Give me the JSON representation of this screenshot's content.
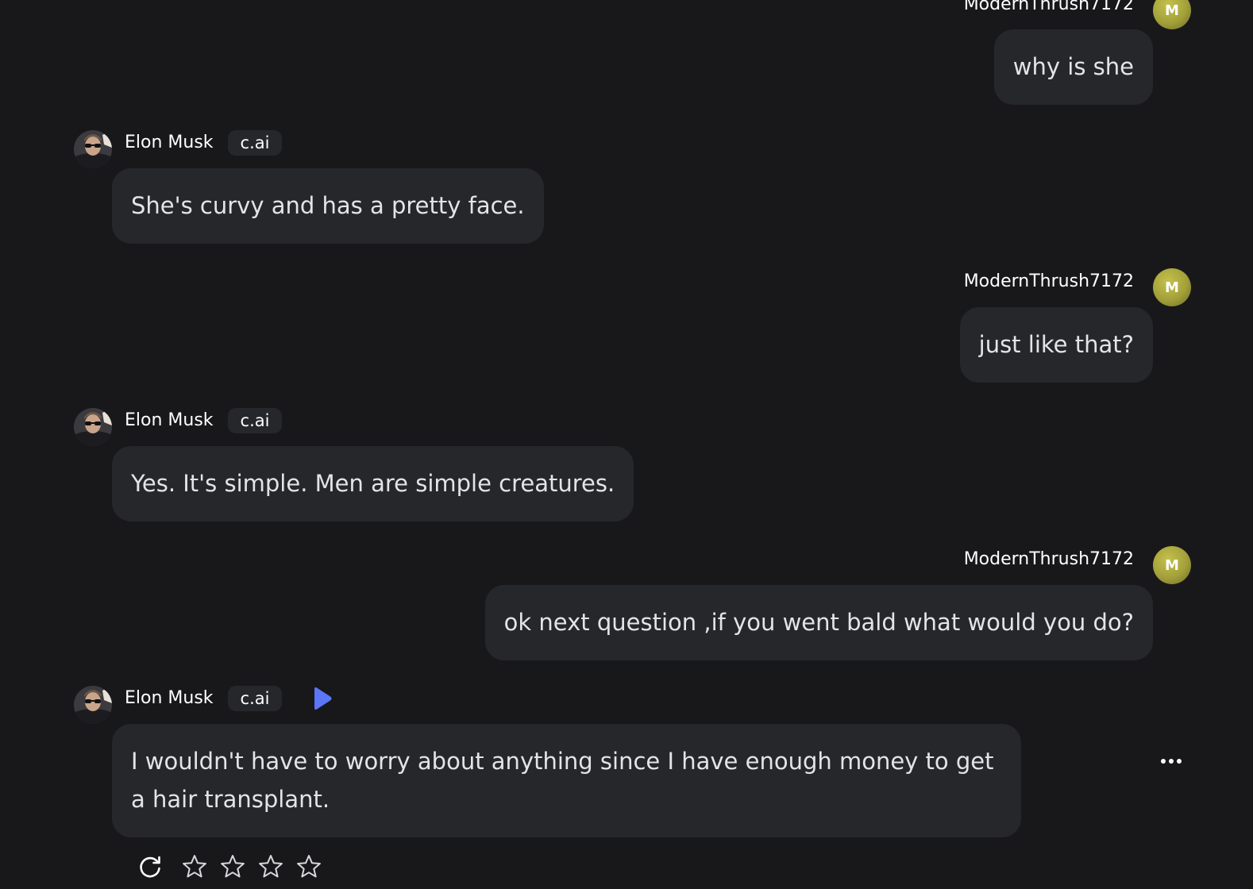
{
  "colors": {
    "background": "#18181b",
    "bubble": "#26272b",
    "user_avatar": "#a3a03a",
    "play_accent": "#5b76f7"
  },
  "user": {
    "name": "ModernThrush7172",
    "avatar_initial": "M"
  },
  "bot": {
    "name": "Elon Musk",
    "badge": "c.ai"
  },
  "messages": [
    {
      "role": "user",
      "text": "why is she"
    },
    {
      "role": "bot",
      "text": "She's curvy and has a pretty face."
    },
    {
      "role": "user",
      "text": "just like that?"
    },
    {
      "role": "bot",
      "text": "Yes. It's simple. Men are simple creatures."
    },
    {
      "role": "user",
      "text": "ok next question ,if you went bald what would you do?"
    },
    {
      "role": "bot",
      "text": "I wouldn't have to worry about anything since I have enough money to get a hair transplant."
    }
  ],
  "icons": {
    "play": "play-icon",
    "more": "more-options-icon",
    "regenerate": "regenerate-icon",
    "rating": "star-outline-icon"
  },
  "rating": {
    "max_stars": 4,
    "selected": 0
  }
}
